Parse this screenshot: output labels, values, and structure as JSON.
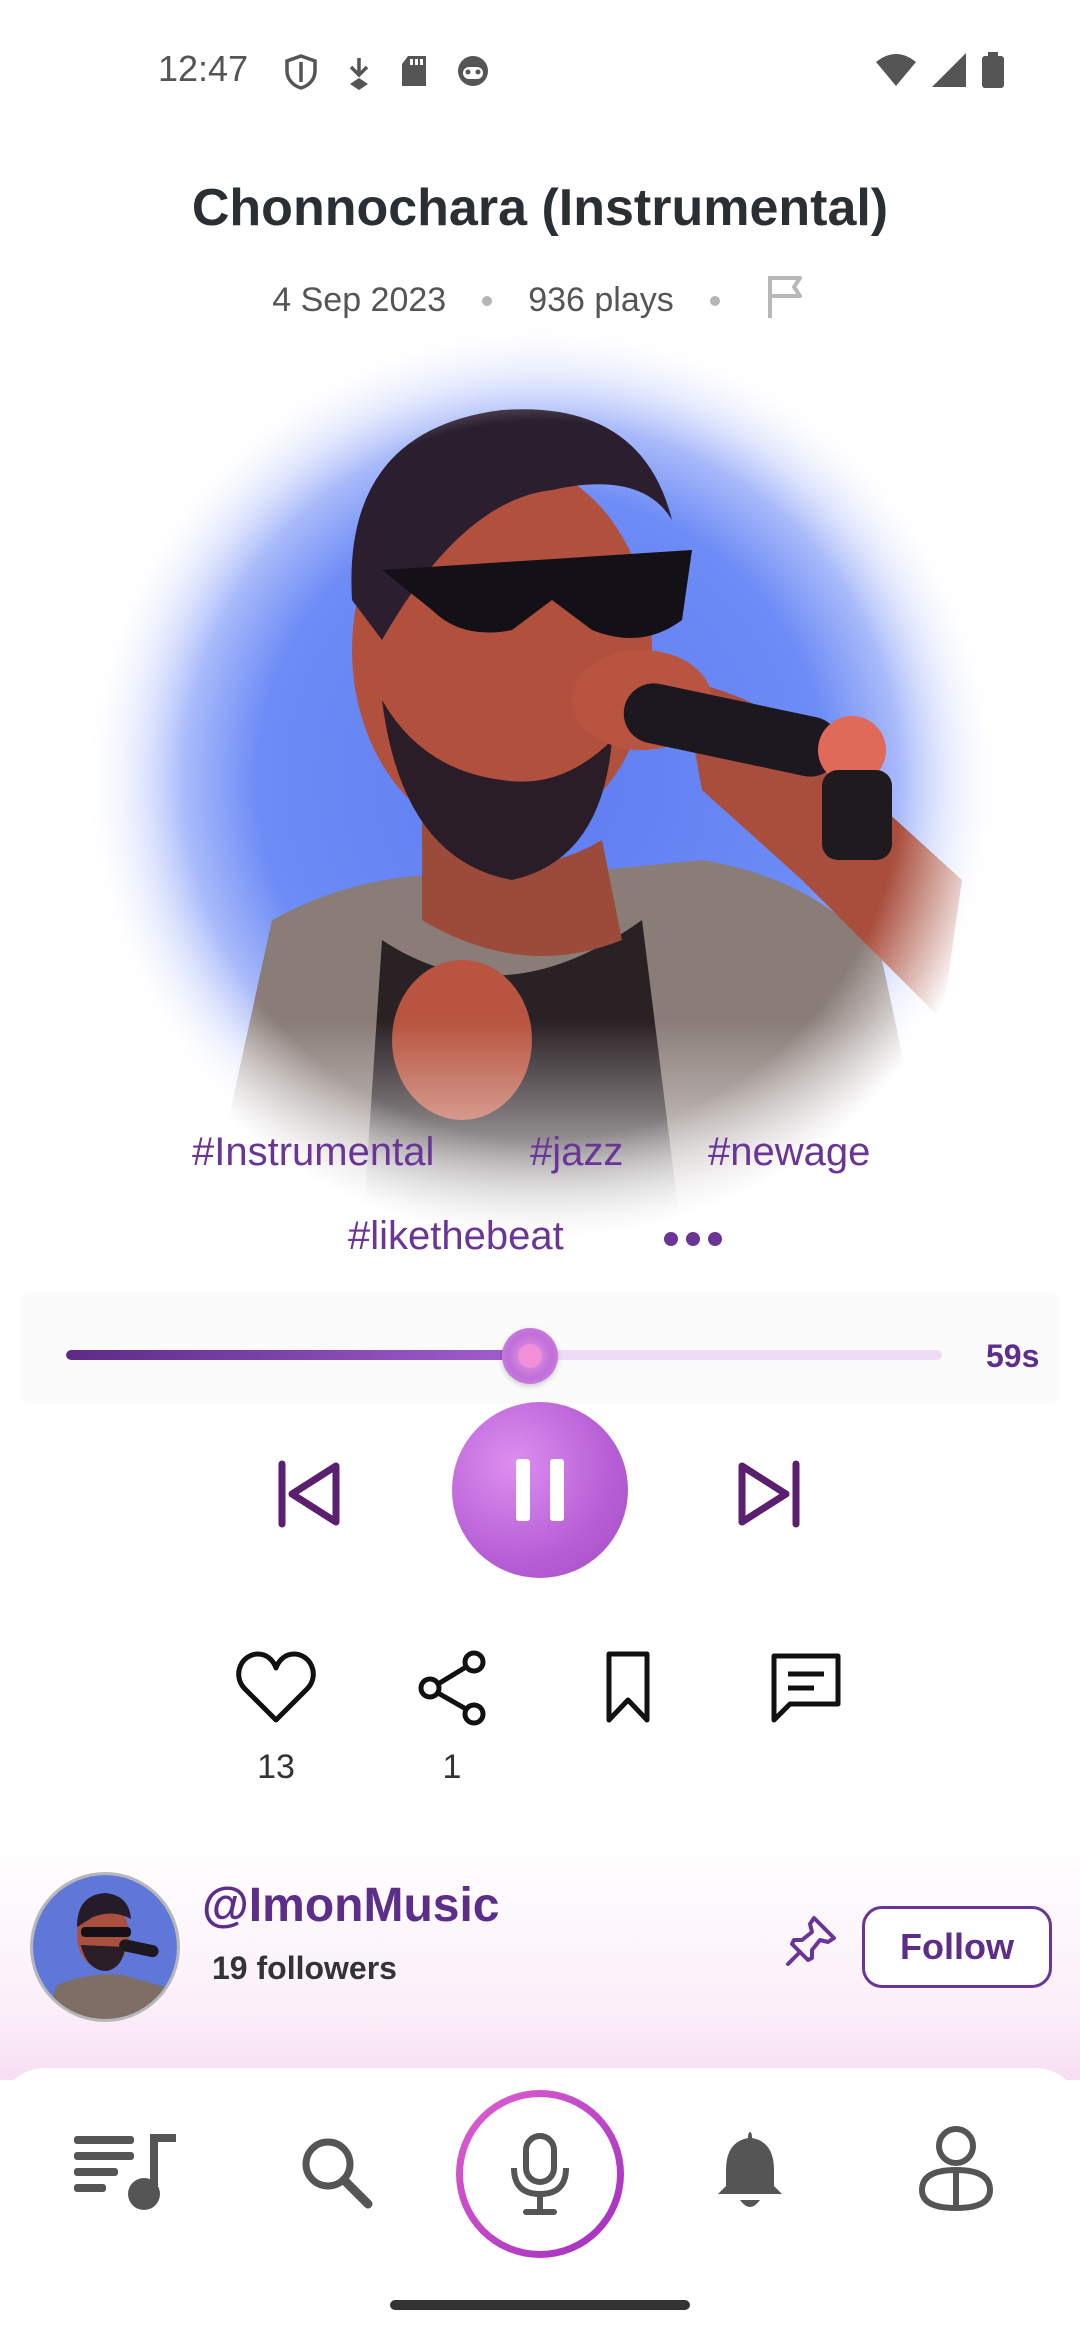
{
  "status_bar": {
    "time": "12:47",
    "left_icons": [
      "shield-icon",
      "download-icon",
      "sd-card-icon",
      "face-icon"
    ],
    "right_icons": [
      "wifi-icon",
      "signal-icon",
      "battery-icon"
    ]
  },
  "track": {
    "title": "Chonnochara (Instrumental)",
    "date": "4 Sep 2023",
    "plays": "936 plays",
    "tags": [
      "#Instrumental",
      "#jazz",
      "#newage",
      "#likethebeat"
    ]
  },
  "player": {
    "progress_fraction": 0.53,
    "time_remaining": "59s",
    "state": "playing"
  },
  "actions": {
    "likes": "13",
    "shares": "1"
  },
  "artist": {
    "handle": "@ImonMusic",
    "followers": "19 followers",
    "follow_label": "Follow"
  },
  "colors": {
    "accent": "#6a3596",
    "play_button": "#b75ed6",
    "mic_ring": "#c03fc8"
  },
  "nav": {
    "items": [
      "playlist-icon",
      "search-icon",
      "mic-icon",
      "bell-icon",
      "profile-icon"
    ]
  }
}
